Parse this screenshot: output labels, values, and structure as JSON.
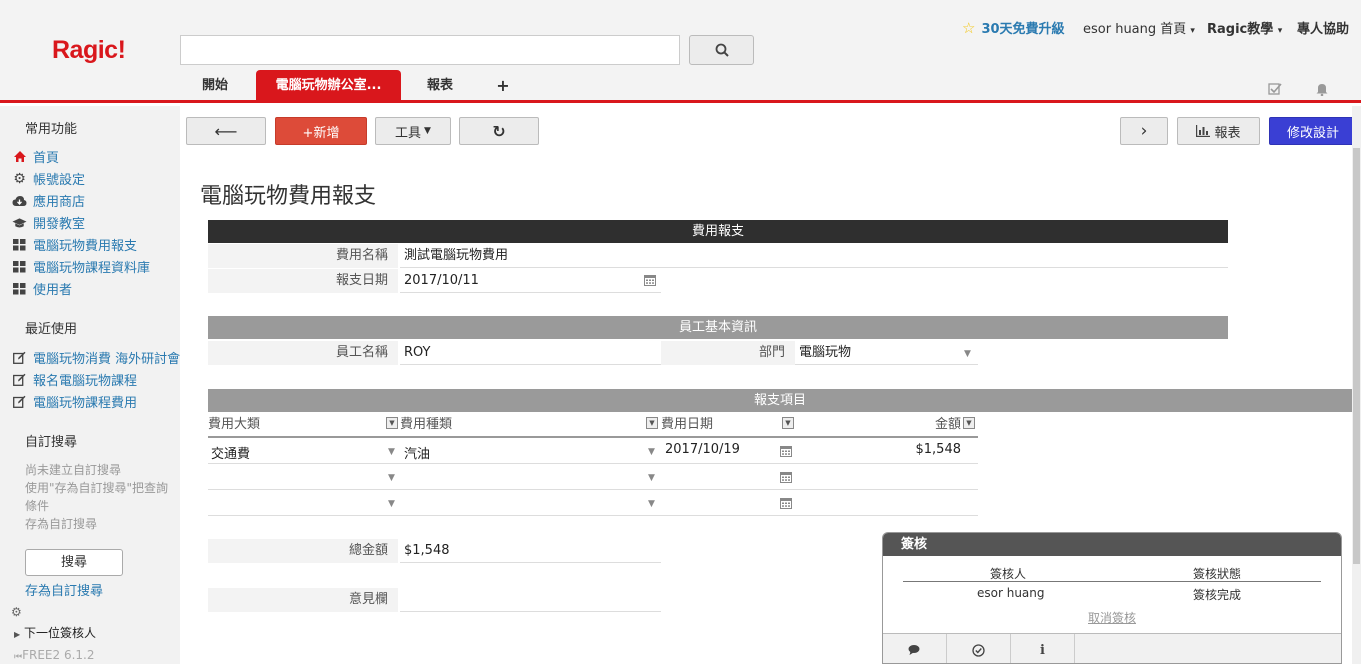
{
  "brand": {
    "logo": "Ragic!"
  },
  "header": {
    "search": {
      "placeholder": ""
    },
    "upgrade": "30天免費升級",
    "user_menu": "esor huang 首頁",
    "teach_menu": "Ragic教學",
    "help": "專人協助"
  },
  "tabs": [
    {
      "label": "開始"
    },
    {
      "label": "電腦玩物辦公室..."
    },
    {
      "label": "報表"
    },
    {
      "label": "+"
    }
  ],
  "sidebar": {
    "common_title": "常用功能",
    "common_items": [
      {
        "label": "首頁",
        "icon": "home-icon"
      },
      {
        "label": "帳號設定",
        "icon": "gear-icon"
      },
      {
        "label": "應用商店",
        "icon": "cloud-download-icon"
      },
      {
        "label": "開發教室",
        "icon": "graduation-cap-icon"
      },
      {
        "label": "電腦玩物費用報支",
        "icon": "grid-icon"
      },
      {
        "label": "電腦玩物課程資料庫",
        "icon": "grid-icon"
      },
      {
        "label": "使用者",
        "icon": "grid-icon"
      }
    ],
    "recent_title": "最近使用",
    "recent_items": [
      {
        "label": "電腦玩物消費 海外研討會"
      },
      {
        "label": "報名電腦玩物課程"
      },
      {
        "label": "電腦玩物課程費用"
      }
    ],
    "custom_title": "自訂搜尋",
    "custom_hint_1": "尚未建立自訂搜尋",
    "custom_hint_2": "使用\"存為自訂搜尋\"把查詢",
    "custom_hint_3": "條件",
    "custom_hint_4": "存為自訂搜尋",
    "search_button": "搜尋",
    "save_search": "存為自訂搜尋",
    "next_approver": "下一位簽核人",
    "version": "FREE2 6.1.2"
  },
  "toolbar": {
    "back": "⟵",
    "new": "+新增",
    "tools": "工具",
    "refresh": "↻",
    "next": "›",
    "report": "報表",
    "design": "修改設計"
  },
  "form": {
    "title": "電腦玩物費用報支",
    "section1": "費用報支",
    "expense_name_label": "費用名稱",
    "expense_name": "測試電腦玩物費用",
    "date_label": "報支日期",
    "date": "2017/10/11",
    "section2": "員工基本資訊",
    "employee_label": "員工名稱",
    "employee": "ROY",
    "dept_label": "部門",
    "dept": "電腦玩物",
    "section3": "報支項目",
    "columns": [
      "費用大類",
      "費用種類",
      "費用日期",
      "金額"
    ],
    "rows": [
      {
        "category": "交通費",
        "type": "汽油",
        "date": "2017/10/19",
        "amount": "$1,548"
      },
      {
        "category": "",
        "type": "",
        "date": "",
        "amount": ""
      },
      {
        "category": "",
        "type": "",
        "date": "",
        "amount": ""
      }
    ],
    "total_label": "總金額",
    "total": "$1,548",
    "comment_label": "意見欄"
  },
  "approval": {
    "title": "簽核",
    "col_approver": "簽核人",
    "col_status": "簽核狀態",
    "approver": "esor huang",
    "status": "簽核完成",
    "cancel": "取消簽核"
  }
}
